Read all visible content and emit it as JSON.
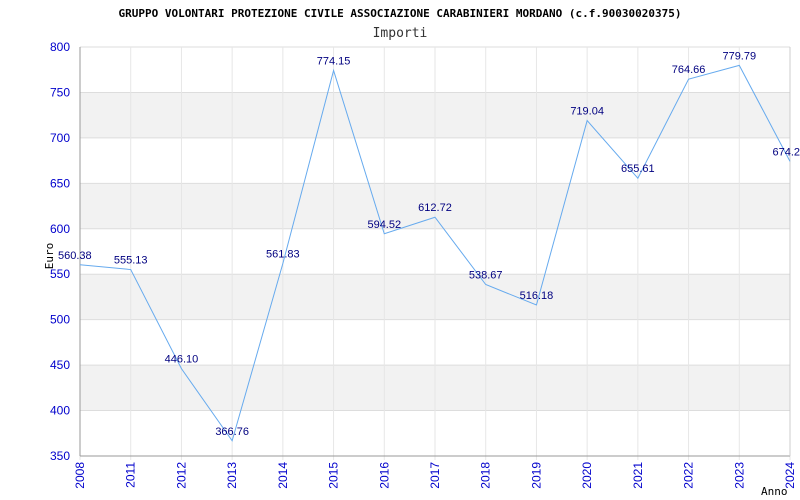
{
  "chart_data": {
    "type": "line",
    "title": "GRUPPO VOLONTARI PROTEZIONE CIVILE ASSOCIAZIONE CARABINIERI MORDANO (c.f.90030020375)",
    "subtitle": "Importi",
    "xlabel": "Anno",
    "ylabel": "Euro",
    "categories": [
      "2008",
      "2011",
      "2012",
      "2013",
      "2014",
      "2015",
      "2016",
      "2017",
      "2018",
      "2019",
      "2020",
      "2021",
      "2022",
      "2023",
      "2024"
    ],
    "series": [
      {
        "values": [
          560.38,
          555.13,
          446.1,
          366.76,
          561.83,
          774.15,
          594.52,
          612.72,
          538.67,
          516.18,
          719.04,
          655.61,
          764.66,
          779.79,
          674.2
        ],
        "labels": [
          "560.38",
          "555.13",
          "446.10",
          "366.76",
          "561.83",
          "774.15",
          "594.52",
          "612.72",
          "538.67",
          "516.18",
          "719.04",
          "655.61",
          "764.66",
          "779.79",
          "674.2"
        ]
      }
    ],
    "ylim": [
      350,
      800
    ],
    "yticks": [
      "350",
      "400",
      "450",
      "500",
      "550",
      "600",
      "650",
      "700",
      "750",
      "800"
    ],
    "grid": true,
    "line_color": "#66aaee",
    "band_color": "#f2f2f2",
    "tick_color": "#0000cc",
    "label_color": "#000080"
  }
}
